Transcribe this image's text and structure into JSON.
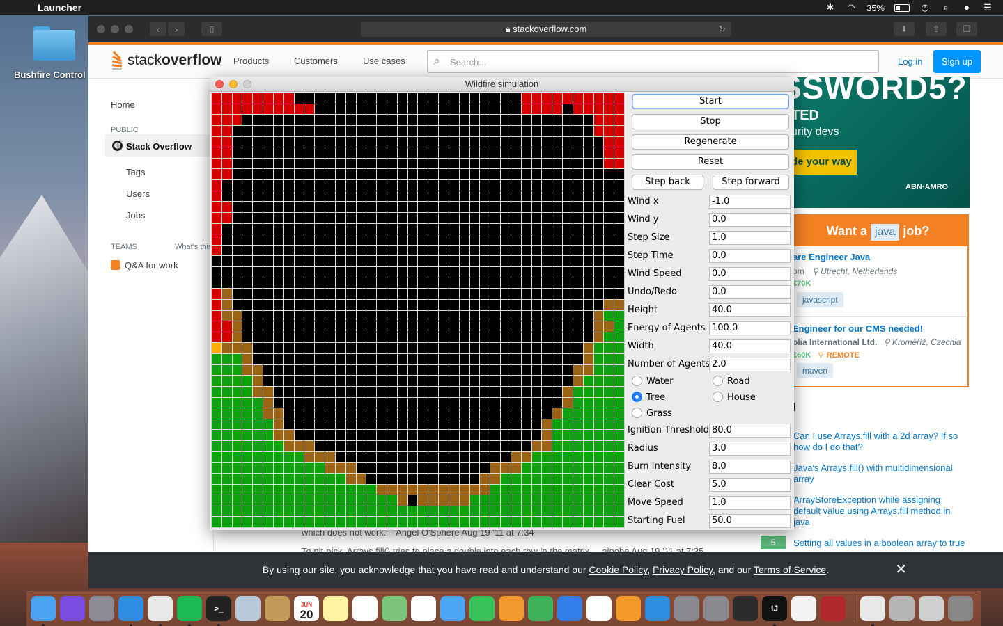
{
  "menubar": {
    "app_name": "Launcher",
    "battery": "35%"
  },
  "desktop": {
    "folder_label": "Bushfire Control"
  },
  "browser": {
    "url": "stackoverflow.com"
  },
  "so": {
    "nav": [
      "Products",
      "Customers",
      "Use cases"
    ],
    "search_placeholder": "Search...",
    "login": "Log in",
    "signup": "Sign up",
    "left": {
      "home": "Home",
      "public": "PUBLIC",
      "stack_overflow": "Stack Overflow",
      "tags": "Tags",
      "users": "Users",
      "jobs": "Jobs",
      "teams": "TEAMS",
      "whats_this": "What's this",
      "qa_for_work": "Q&A for work"
    },
    "ad": {
      "big": "SSWORD5?",
      "line1": "TED",
      "line2": "urity devs",
      "cta": "de your way",
      "brand": "ABN·AMRO"
    },
    "jobs_box": {
      "title_pre": "Want a",
      "title_tag": "java",
      "title_post": "job?",
      "job1_title": "are Engineer Java",
      "job1_company": "om",
      "job1_location": "Utrecht, Netherlands",
      "job1_salary": "€70K",
      "job1_tag": "javascript",
      "job2_title": "Engineer for our CMS needed!",
      "job2_company": "olia International Ltd.",
      "job2_location": "Kroměříž, Czechia",
      "job2_salary": "€60K",
      "job2_remote": "REMOTE",
      "job2_tag": "maven"
    },
    "related_header": "d",
    "related": [
      "Can I use Arrays.fill with a 2d array? If so how do I do that?",
      "Java's Arrays.fill() with multidimensional array",
      "ArrayStoreException while assigning default value using Arrays.fill method in java",
      "Setting all values in a boolean array to true"
    ],
    "vote": "5",
    "comment1": "which does not work. – Angel O'Sphere Aug 19 '11 at 7:34",
    "comment2": "To nit-pick, Arrays.fill() tries to place a double into each row in the matrix. – aioobe Aug 19 '11 at 7:35",
    "cookie": {
      "pre": "By using our site, you acknowledge that you have read and understand our",
      "cookie_policy": "Cookie Policy",
      "comma": ",",
      "privacy_policy": "Privacy Policy",
      "and_our": ", and our",
      "terms": "Terms of Service",
      "period": "."
    }
  },
  "sim": {
    "title": "Wildfire simulation",
    "buttons": {
      "start": "Start",
      "stop": "Stop",
      "regenerate": "Regenerate",
      "reset": "Reset",
      "step_back": "Step back",
      "step_forward": "Step forward"
    },
    "fields": [
      {
        "label": "Wind x",
        "value": "-1.0"
      },
      {
        "label": "Wind y",
        "value": "0.0"
      },
      {
        "label": "Step Size",
        "value": "1.0"
      },
      {
        "label": "Step Time",
        "value": "0.0"
      },
      {
        "label": "Wind Speed",
        "value": "0.0"
      },
      {
        "label": "Undo/Redo",
        "value": "0.0"
      },
      {
        "label": "Height",
        "value": "40.0"
      },
      {
        "label": "Energy of Agents",
        "value": "100.0"
      },
      {
        "label": "Width",
        "value": "40.0"
      },
      {
        "label": "Number of Agents",
        "value": "2.0"
      }
    ],
    "terrain": {
      "water": "Water",
      "road": "Road",
      "tree": "Tree",
      "house": "House",
      "grass": "Grass",
      "selected": "Tree"
    },
    "fields2": [
      {
        "label": "Ignition Threshold",
        "value": "80.0"
      },
      {
        "label": "Radius",
        "value": "3.0"
      },
      {
        "label": "Burn Intensity",
        "value": "8.0"
      },
      {
        "label": "Clear Cost",
        "value": "5.0"
      },
      {
        "label": "Move Speed",
        "value": "1.0"
      },
      {
        "label": "Starting Fuel",
        "value": "50.0"
      }
    ],
    "grid": {
      "cols": 40,
      "rows": 40,
      "legend": {
        "g": "#0ea10e",
        "r": "#d50000",
        "b": "#9a6414",
        "o": "#ffae00",
        "k": "#000000"
      },
      "cells": [
        "rrrrrrrrkkkkkkkkkkkkkkkkkkkkkkrrrrrrrrrr",
        "rrrrrrrrrrkkkkkkkkkkkkkkkkkkkkrrrrkrrrrr",
        "rrrkkkkkkkkkkkkkkkkkkkkkkkkkkkkkkkkkkrrr",
        "rrkkkkkkkkkkkkkkkkkkkkkkkkkkkkkkkkkkkrrr",
        "rrkkkkkkkkkkkkkkkkkkkkkkkkkkkkkkkkkkkkrr",
        "rrkkkkkkkkkkkkkkkkkkkkkkkkkkkkkkkkkkkkrr",
        "rrkkkkkkkkkkkkkkkkkkkkkkkkkkkkkkkkkkkkrr",
        "rrkkkkkkkkkkkkkkkkkkkkkkkkkkkkkkkkkkkkkk",
        "rkkkkkkkkkkkkkkkkkkkkkkkkkkkkkkkkkkkkkkk",
        "rkkkkkkkkkkkkkkkkkkkkkkkkkkkkkkkkkkkkkkk",
        "rrkkkkkkkkkkkkkkkkkkkkkkkkkkkkkkkkkkkkkk",
        "rrkkkkkkkkkkkkkkkkkkkkkkkkkkkkkkkkkkkkkk",
        "rkkkkkkkkkkkkkkkkkkkkkkkkkkkkkkkkkkkkkkk",
        "rkkkkkkkkkkkkkkkkkkkkkkkkkkkkkkkkkkkkkkk",
        "rkkkkkkkkkkkkkkkkkkkkkkkkkkkkkkkkkkkkkkk",
        "kkkkkkkkkkkkkkkkkkkkkkkkkkkkkkkkkkkkkkkk",
        "kkkkkkkkkkkkkkkkkkkkkkkkkkkkkkkkkkkkkkkk",
        "kkkkkkkkkkkkkkkkkkkkkkkkkkkkkkkkkkkkkkkk",
        "rbkkkkkkkkkkkkkkkkkkkkkkkkkkkkkkkkkkkkkk",
        "rbkkkkkkkkkkkkkkkkkkkkkkkkkkkkkkkkkkkkbb",
        "rbbkkkkkkkkkkkkkkkkkkkkkkkkkkkkkkkkkkbgg",
        "rrbkkkkkkkkkkkkkkkkkkkkkkkkkkkkkkkkkkbbg",
        "rrbkkkkkkkkkkkkkkkkkkkkkkkkkkkkkkkkkkbgg",
        "obbbkkkkkkkkkkkkkkkkkkkkkkkkkkkkkkkkbggg",
        "gggbkkkkkkkkkkkkkkkkkkkkkkkkkkkkkkkkbggg",
        "gggbbkkkkkkkkkkkkkkkkkkkkkkkkkkkkkkbbggg",
        "ggggbkkkkkkkkkkkkkkkkkkkkkkkkkkkkkkbgggg",
        "ggggbbkkkkkkkkkkkkkkkkkkkkkkkkkkkkbggggg",
        "gggggbkkkkkkkkkkkkkkkkkkkkkkkkkkkkbggggg",
        "gggggbbkkkkkkkkkkkkkkkkkkkkkkkkkkbgggggg",
        "ggggggbkkkkkkkkkkkkkkkkkkkkkkkkkbggggggg",
        "ggggggbbkkkkkkkkkkkkkkkkkkkkkkkkbggggggg",
        "gggggggbbbkkkkkkkkkkkkkkkkkkkkkbbggggggg",
        "gggggggggbbbkkkkkkkkkkkkkkkkkbbggggggggg",
        "gggggggggggbbbkkkkkkkkkkkkkbbbgggggggggg",
        "gggggggggggggbbkkkkkkkkkkkbbgggggggggggg",
        "ggggggggggggggggbbbbbbbbbbbggggggggggggg",
        "ggggggggggggggggggbkbbbbbggggggggggggggg",
        "gggggggggggggggggggggggggggggggggggggggg",
        "gggggggggggggggggggggggggggggggggggggggg"
      ]
    }
  },
  "dock": [
    "Finder",
    "Siri",
    "Launchpad",
    "Safari",
    "Chrome",
    "Spotify",
    "Terminal",
    "Preview",
    "Notebook",
    "Calendar",
    "Notes",
    "Reminders",
    "Maps",
    "Photos",
    "Messages",
    "FaceTime",
    "Pages",
    "Numbers",
    "Keynote",
    "iTunes",
    "iBooks",
    "App Store",
    "System Preferences",
    "Image Capture",
    "Scanner",
    "IntelliJ",
    "TextEdit",
    "Photo Booth",
    "Java",
    "Archive",
    "Downloads",
    "Trash"
  ],
  "dock_calendar": {
    "month": "JUN",
    "day": "20"
  }
}
